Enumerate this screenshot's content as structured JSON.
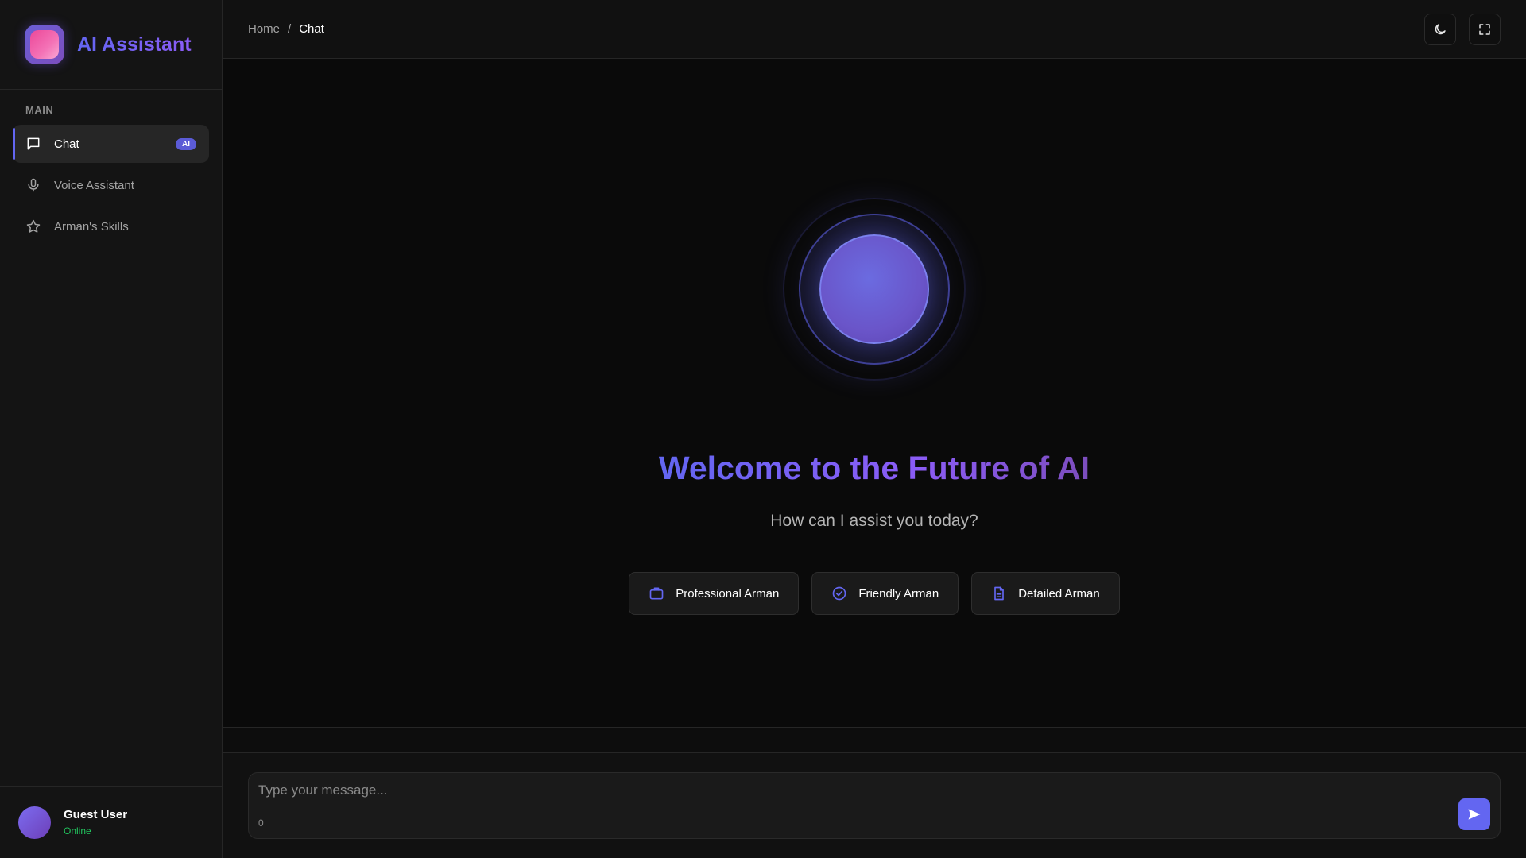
{
  "sidebar": {
    "brand_title": "AI Assistant",
    "section_label": "MAIN",
    "items": [
      {
        "label": "Chat",
        "icon": "message-icon",
        "badge": "AI",
        "active": true
      },
      {
        "label": "Voice Assistant",
        "icon": "microphone-icon",
        "active": false
      },
      {
        "label": "Arman's Skills",
        "icon": "star-icon",
        "active": false
      }
    ],
    "user": {
      "name": "Guest User",
      "status": "Online"
    }
  },
  "header": {
    "breadcrumb": [
      "Home",
      "/",
      "Chat"
    ],
    "actions": [
      "moon-icon",
      "fullscreen-icon"
    ]
  },
  "main": {
    "title": "Welcome to the Future of AI",
    "subtitle": "How can I assist you today?",
    "personas": [
      {
        "label": "Professional Arman",
        "icon": "briefcase-icon"
      },
      {
        "label": "Friendly Arman",
        "icon": "check-circle-icon"
      },
      {
        "label": "Detailed Arman",
        "icon": "document-icon"
      }
    ]
  },
  "composer": {
    "placeholder": "Type your message...",
    "value": "",
    "char_count": "0"
  },
  "colors": {
    "accent": "#6366f1",
    "accent_secondary": "#8b5cf6",
    "status_online": "#22c55e",
    "background": "#0a0a0a"
  }
}
